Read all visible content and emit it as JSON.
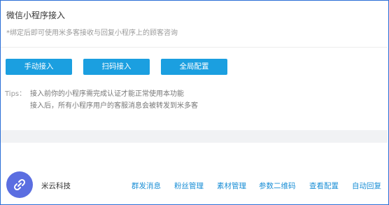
{
  "header": {
    "title": "微信小程序接入",
    "subtitle": "*绑定后即可使用米多客接收与回复小程序上的顾客咨询"
  },
  "buttons": {
    "manual": "手动接入",
    "scan": "扫码接入",
    "global": "全局配置"
  },
  "tips": {
    "label": "Tips：",
    "line1": "接入前你的小程序需完成认证才能正常使用本功能",
    "line2": "接入后，所有小程序用户的客服消息会被转发到米多客"
  },
  "footer": {
    "brand": "米云科技",
    "nav": [
      "群发消息",
      "粉丝管理",
      "素材管理",
      "参数二维码",
      "查看配置",
      "自动回复"
    ]
  }
}
